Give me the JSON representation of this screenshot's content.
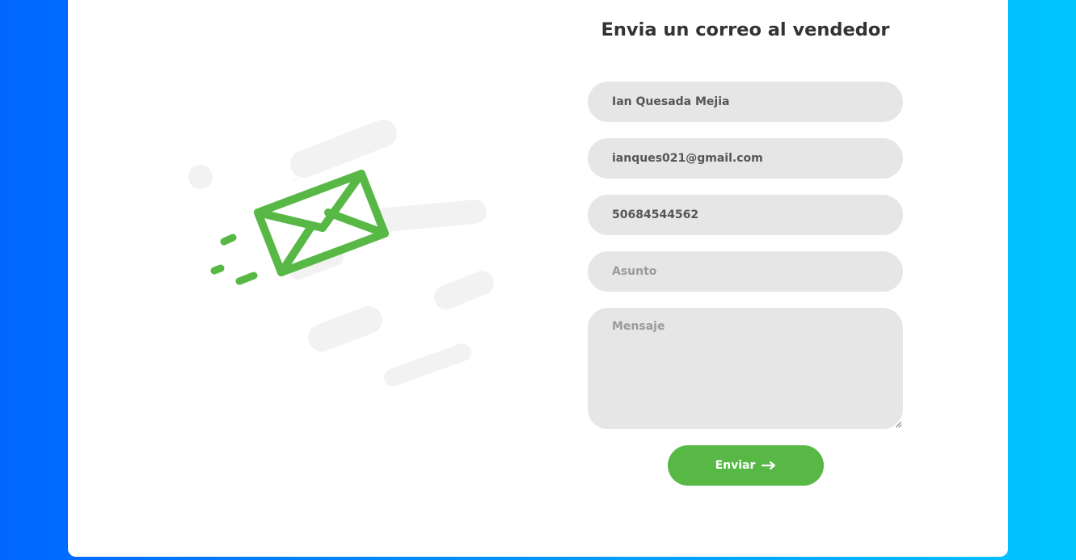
{
  "form": {
    "title": "Envia un correo al vendedor",
    "name_value": "Ian Quesada Mejia",
    "email_value": "ianques021@gmail.com",
    "phone_value": "50684544562",
    "subject_placeholder": "Asunto",
    "message_placeholder": "Mensaje",
    "submit_label": "Enviar",
    "submit_icon": "arrow-right-icon"
  },
  "illustration": {
    "icon": "envelope-icon"
  },
  "colors": {
    "accent": "#57b846",
    "field_background": "#e6e6e6",
    "title_text": "#333333",
    "background_gradient_start": "#0066ff",
    "background_gradient_end": "#00c6ff"
  }
}
